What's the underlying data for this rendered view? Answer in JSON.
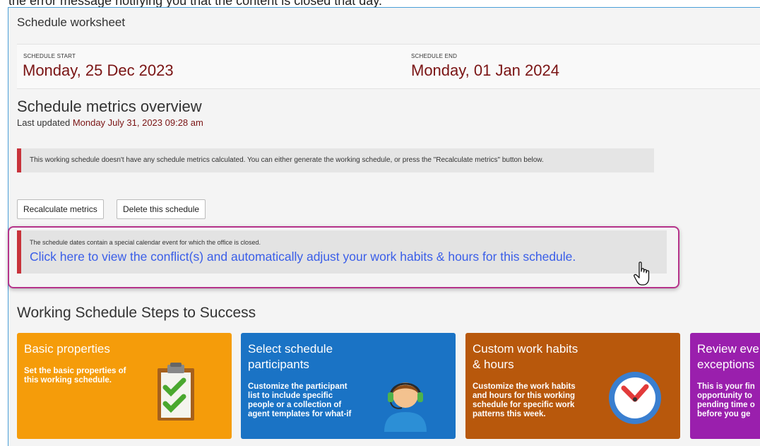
{
  "top_text": "the error message notifying you that the content is closed that day.",
  "worksheet": {
    "title": "Schedule worksheet"
  },
  "schedule_start": {
    "label": "SCHEDULE START",
    "value": "Monday, 25 Dec 2023"
  },
  "schedule_end": {
    "label": "SCHEDULE END",
    "value": "Monday, 01 Jan 2024"
  },
  "metrics": {
    "heading": "Schedule metrics overview",
    "updated_prefix": "Last updated",
    "updated_value": "Monday July 31, 2023 09:28 am",
    "warning": "This working schedule doesn't have any schedule metrics calculated. You can either generate the working schedule, or press the \"Recalculate metrics\" button below."
  },
  "buttons": {
    "recalculate": "Recalculate metrics",
    "delete": "Delete this schedule"
  },
  "conflict": {
    "message": "The schedule dates contain a special calendar event for which the office is closed.",
    "link": "Click here to view the conflict(s) and automatically adjust your work habits & hours for this schedule."
  },
  "steps": {
    "heading": "Working Schedule Steps to Success",
    "cards": [
      {
        "title": "Basic properties",
        "desc": "Set the basic properties of\nthis working schedule.",
        "icon": "clipboard-check-icon",
        "color": "#f59c0a"
      },
      {
        "title": "Select schedule\nparticipants",
        "desc": "Customize the participant\nlist to include specific\npeople or a collection of\nagent templates for what-if",
        "icon": "headset-agent-icon",
        "color": "#1a73c5"
      },
      {
        "title": "Custom work habits\n& hours",
        "desc": "Customize the work habits\nand hours for this working\nschedule for specific work\npatterns this week.",
        "icon": "clock-icon",
        "color": "#b8580c"
      },
      {
        "title": "Review eve\nexceptions",
        "desc": "This is your fin\nopportunity to\npending time o\nbefore you ge",
        "icon": "",
        "color": "#9a1fad"
      }
    ]
  }
}
